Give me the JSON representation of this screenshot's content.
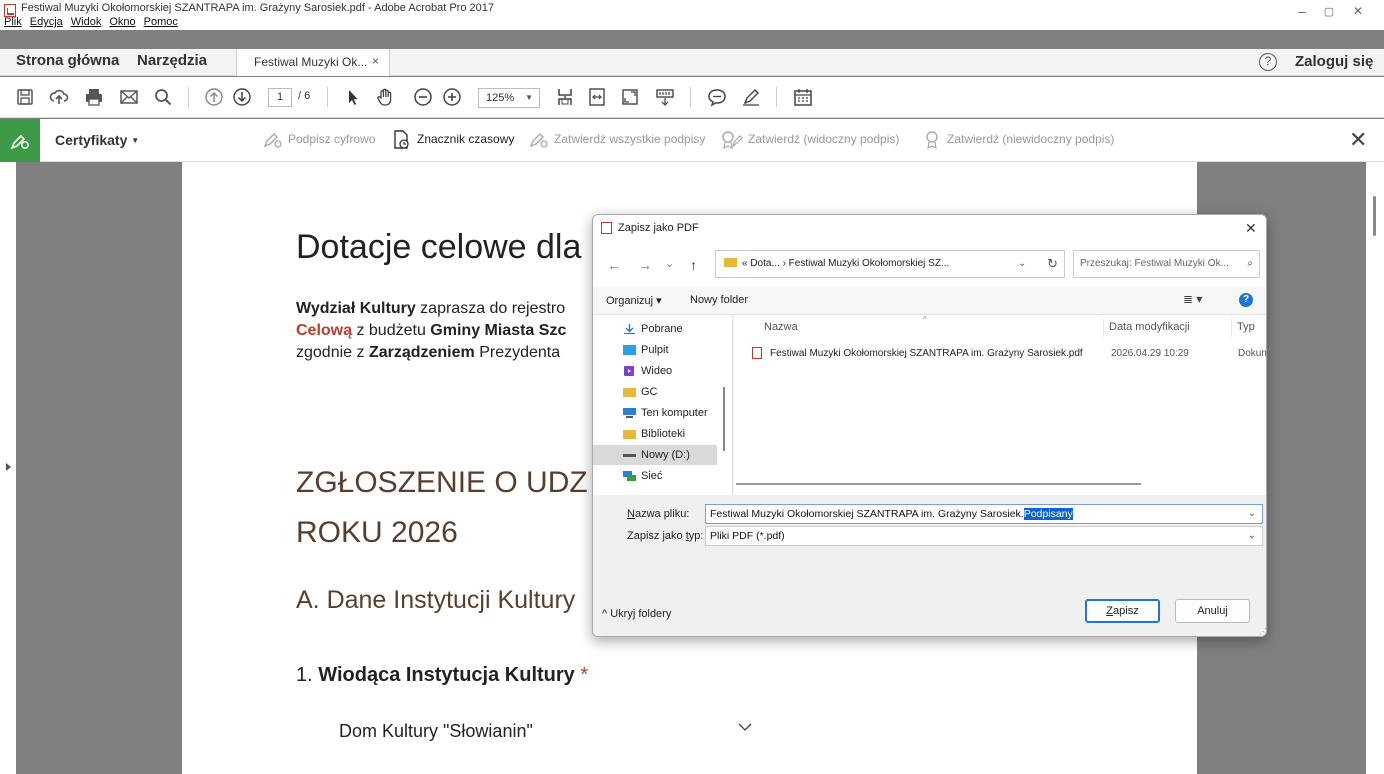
{
  "window": {
    "title": "Festiwal Muzyki Okołomorskiej SZANTRAPA im. Grażyny Sarosiek.pdf - Adobe Acrobat Pro 2017",
    "minimize": "–",
    "maximize": "▢",
    "close": "✕"
  },
  "menu": [
    "Plik",
    "Edycja",
    "Widok",
    "Okno",
    "Pomoc"
  ],
  "tabs": {
    "home": "Strona główna",
    "tools": "Narzędzia",
    "document": "Festiwal Muzyki Ok...",
    "document_close": "×",
    "help": "?",
    "login": "Zaloguj się"
  },
  "toolbar": {
    "page_current": "1",
    "page_total": "/ 6",
    "zoom": "125%",
    "zoom_caret": "▼",
    "icons": [
      "save-icon",
      "upload-icon",
      "print-icon",
      "mail-icon",
      "search-icon",
      "page-up-icon",
      "page-down-icon",
      "select-arrow-icon",
      "hand-icon",
      "zoom-out-icon",
      "zoom-in-icon",
      "fit-page-icon",
      "fit-width-icon",
      "full-screen-icon",
      "read-mode-icon",
      "comment-icon",
      "pen-icon",
      "calendar-icon"
    ]
  },
  "certbar": {
    "label": "Certyfikaty",
    "caret": "▼",
    "actions": {
      "sign": "Podpisz cyfrowo",
      "timestamp": "Znacznik czasowy",
      "validate_all": "Zatwierdź wszystkie podpisy",
      "visible": "Zatwierdź (widoczny podpis)",
      "invisible": "Zatwierdź (niewidoczny podpis)"
    },
    "close": "✕"
  },
  "document": {
    "heading": "Dotacje celowe dla",
    "para_line1_bold": "Wydział Kultury",
    "para_line1_rest": " zaprasza do rejestro",
    "para_line2_red": "Celową",
    "para_line2_mid": " z budżetu ",
    "para_line2_bold": "Gminy Miasta Szc",
    "para_line3_start": "zgodnie z ",
    "para_line3_bold": "Zarządzeniem",
    "para_line3_rest": " Prezydenta",
    "section_line1": "ZGŁOSZENIE O UDZ",
    "section_line2": "ROKU 2026",
    "subsection": "A. Dane Instytucji Kultury",
    "q1_number": "1.",
    "q1_label": "Wiodąca Instytucja Kultury",
    "q1_required": "*",
    "q1_answer": "Dom Kultury \"Słowianin\""
  },
  "dialog": {
    "title": "Zapisz jako PDF",
    "close": "✕",
    "nav": {
      "back": "←",
      "forward": "→",
      "recent": "⌄",
      "up": "↑"
    },
    "address": "« Dota... › Festiwal Muzyki Okołomorskiej SZ...",
    "address_dropdown": "⌄",
    "refresh": "↻",
    "search_placeholder": "Przeszukaj: Festiwal Muzyki Ok...",
    "organize": "Organizuj ▾",
    "new_folder": "Nowy folder",
    "view_icon": "≣ ▾",
    "help": "?",
    "nav_items": [
      {
        "label": "Pobrane",
        "icon": "download-icon"
      },
      {
        "label": "Pulpit",
        "icon": "desktop-icon"
      },
      {
        "label": "Wideo",
        "icon": "video-icon"
      },
      {
        "label": "GC",
        "icon": "folder-icon"
      },
      {
        "label": "Ten komputer",
        "icon": "computer-icon"
      },
      {
        "label": "Biblioteki",
        "icon": "library-icon"
      },
      {
        "label": "Nowy (D:)",
        "icon": "drive-icon"
      },
      {
        "label": "Sieć",
        "icon": "network-icon"
      }
    ],
    "columns": {
      "name": "Nazwa",
      "modified": "Data modyfikacji",
      "type": "Typ"
    },
    "files": [
      {
        "name": "Festiwal Muzyki Okołomorskiej SZANTRAPA im. Grażyny Sarosiek.pdf",
        "modified": "2026.04.29 10:29",
        "type": "Dokum"
      }
    ],
    "filename_label_u": "N",
    "filename_label_rest": "azwa pliku:",
    "filename_value": "Festiwal Muzyki Okołomorskiej SZANTRAPA im. Grażyny Sarosiek.",
    "filename_selected": "Podpisany",
    "filetype_label_start": "Zapisz jako ",
    "filetype_label_u": "t",
    "filetype_label_rest": "yp:",
    "filetype_value": "Pliki PDF (*.pdf)",
    "hide_folders": "^  Ukryj foldery",
    "save_u": "Z",
    "save_rest": "apisz",
    "cancel": "Anuluj"
  }
}
